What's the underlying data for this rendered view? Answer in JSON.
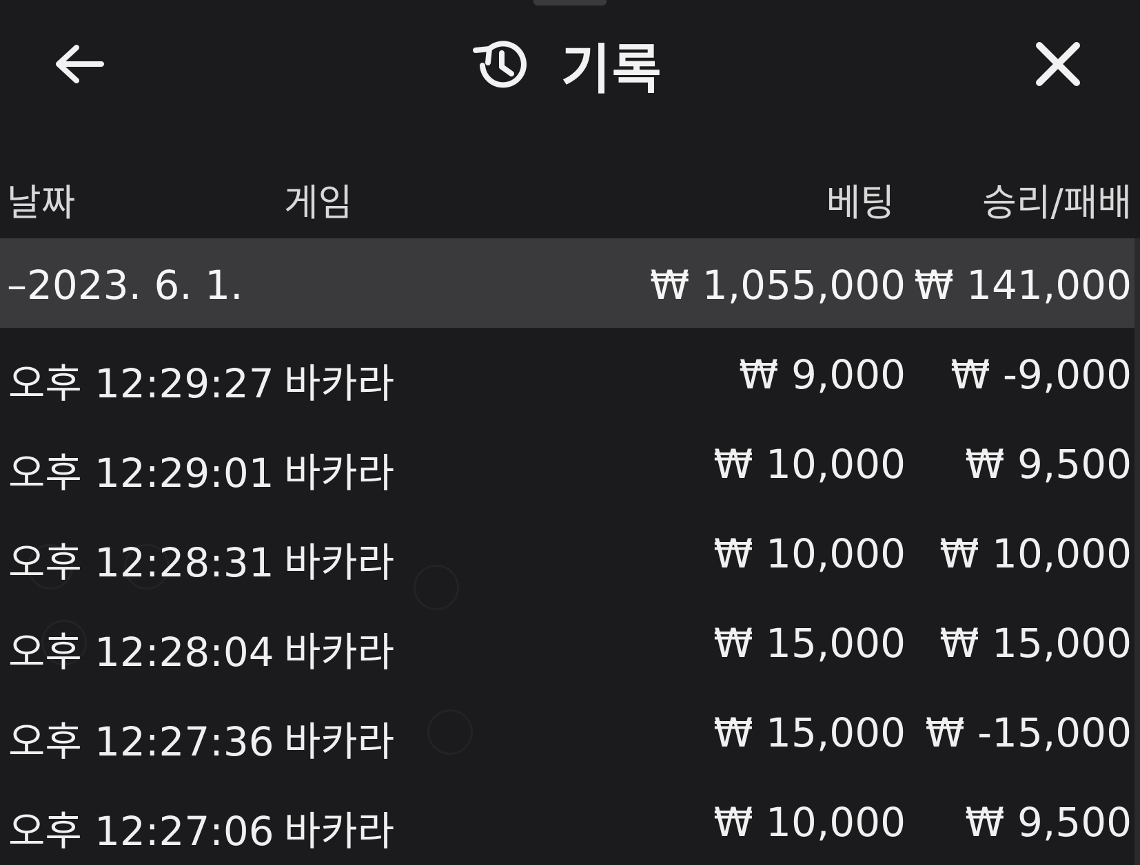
{
  "header": {
    "back_icon": "arrow-left-icon",
    "history_icon": "history-clock-icon",
    "title": "기록",
    "close_icon": "close-icon"
  },
  "columns": {
    "date": "날짜",
    "game": "게임",
    "bet": "베팅",
    "result": "승리/패배"
  },
  "day_group": {
    "date": "–2023. 6. 1.",
    "bet_total": "₩ 1,055,000",
    "result_total": "₩ 141,000"
  },
  "rows": [
    {
      "time": "오후 12:29:27",
      "game": "바카라",
      "bet": "₩ 9,000",
      "result": "₩ -9,000"
    },
    {
      "time": "오후 12:29:01",
      "game": "바카라",
      "bet": "₩ 10,000",
      "result": "₩ 9,500"
    },
    {
      "time": "오후 12:28:31",
      "game": "바카라",
      "bet": "₩ 10,000",
      "result": "₩ 10,000"
    },
    {
      "time": "오후 12:28:04",
      "game": "바카라",
      "bet": "₩ 15,000",
      "result": "₩ 15,000"
    },
    {
      "time": "오후 12:27:36",
      "game": "바카라",
      "bet": "₩ 15,000",
      "result": "₩ -15,000"
    },
    {
      "time": "오후 12:27:06",
      "game": "바카라",
      "bet": "₩ 10,000",
      "result": "₩ 9,500"
    }
  ],
  "colors": {
    "background": "#1b1b1e",
    "day_row": "#3a3a3d",
    "text": "#f0f0f0"
  }
}
